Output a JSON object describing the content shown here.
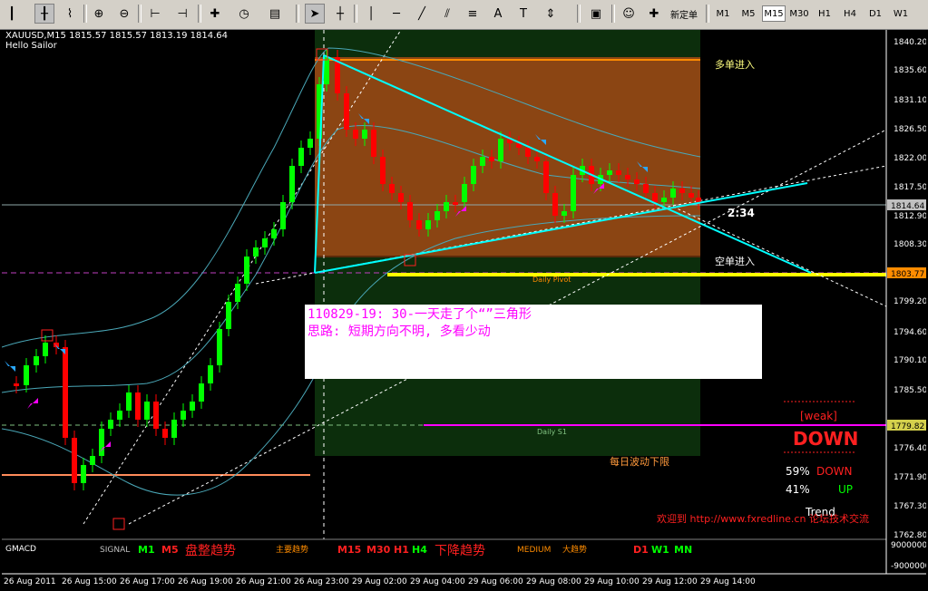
{
  "toolbar": {
    "new_order_label": "新定单",
    "timeframes": [
      "M1",
      "M5",
      "M15",
      "M30",
      "H1",
      "H4",
      "D1",
      "W1"
    ],
    "active_timeframe": "M15"
  },
  "chart": {
    "symbol_info": "XAUUSD,M15  1815.57 1815.57 1813.19 1814.64",
    "ea_name": "Hello Sailor",
    "current_price_tag": "1814.64",
    "pivot_price_tag": "1803.77",
    "s1_price_tag": "1779.82",
    "pivot_label": "Daily Pivot",
    "s1_label": "Daily S1",
    "multi_entry_label": "多单进入",
    "short_entry_label": "空单进入",
    "daily_low_label": "每日波动下限",
    "countdown": "2:34",
    "note_line1": "110829-19: 30-一天走了个“”三角形",
    "note_line2": "思路: 短期方向不明, 多看少动",
    "weak_label": "[weak]",
    "direction_label": "DOWN",
    "down_pct": "59%",
    "down_word": "DOWN",
    "up_pct": "41%",
    "up_word": "UP",
    "trend_label": "Trend",
    "welcome_text": "欢迎到 http://www.fxredline.cn 论坛技术交流",
    "price_axis": [
      "1840.20",
      "1835.60",
      "1831.10",
      "1826.50",
      "1822.00",
      "1817.50",
      "1812.90",
      "1808.30",
      "1803.77",
      "1799.20",
      "1794.60",
      "1790.10",
      "1785.50",
      "1779.82",
      "1776.40",
      "1771.90",
      "1767.30",
      "1762.80"
    ],
    "indicator_axis_top": "9000000",
    "indicator_axis_bottom": "-9000000",
    "time_axis": [
      "26 Aug 2011",
      "26 Aug 15:00",
      "26 Aug 17:00",
      "26 Aug 19:00",
      "26 Aug 21:00",
      "26 Aug 23:00",
      "29 Aug 02:00",
      "29 Aug 04:00",
      "29 Aug 06:00",
      "29 Aug 08:00",
      "29 Aug 10:00",
      "29 Aug 12:00",
      "29 Aug 14:00"
    ]
  },
  "indicator": {
    "name": "GMACD",
    "signal_label": "SIGNAL",
    "group1_tfs": [
      "M1",
      "M5"
    ],
    "group1_trend": "盘整趋势",
    "group1_sub": "主要趋势",
    "group2_tfs": [
      "M15",
      "M30",
      "H1",
      "H4"
    ],
    "group2_trend": "下降趋势",
    "medium_label": "MEDIUM",
    "medium_sub": "大趋势",
    "group3_tfs": [
      "D1",
      "W1",
      "MN"
    ]
  },
  "colors": {
    "bull": "#00ff00",
    "bear": "#ff0000",
    "zone": "#8b4513",
    "trendline": "#00ffff",
    "pivot": "#ffff00",
    "accent_magenta": "#ff00ff",
    "red_text": "#ff2020",
    "orange_text": "#ff8c00"
  }
}
